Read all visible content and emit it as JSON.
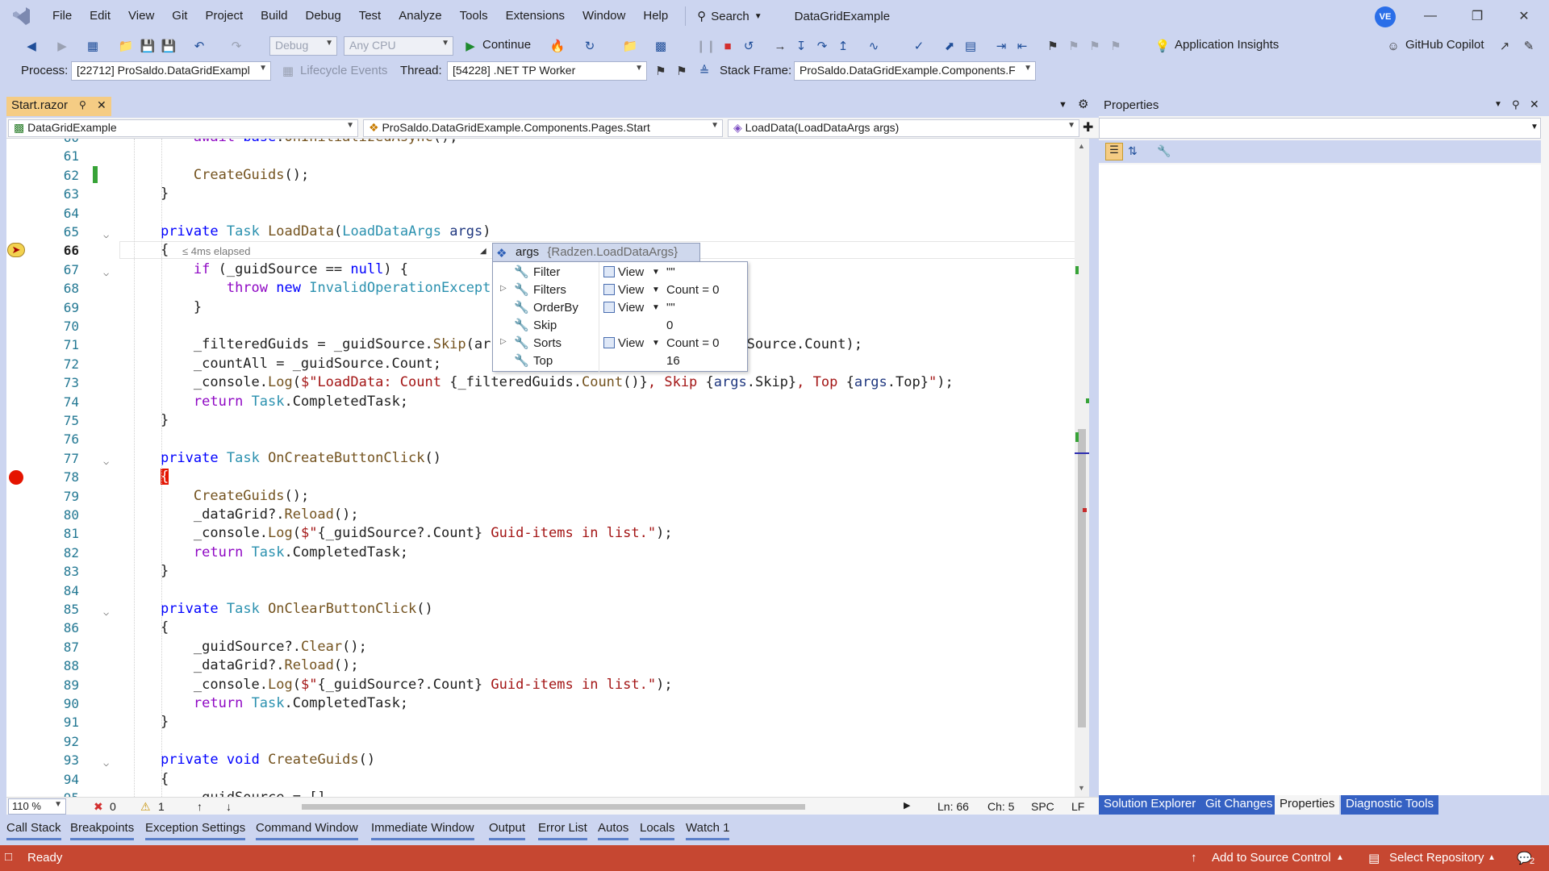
{
  "menu": [
    "File",
    "Edit",
    "View",
    "Git",
    "Project",
    "Build",
    "Debug",
    "Test",
    "Analyze",
    "Tools",
    "Extensions",
    "Window",
    "Help"
  ],
  "search_label": "Search",
  "solution_name": "DataGridExample",
  "avatar_initials": "VE",
  "toolbar": {
    "config": "Debug",
    "platform": "Any CPU",
    "continue_label": "Continue",
    "app_insights": "Application Insights",
    "copilot": "GitHub Copilot"
  },
  "debug_location": {
    "process_label": "Process:",
    "process_value": "[22712] ProSaldo.DataGridExampl",
    "lifecycle": "Lifecycle Events",
    "thread_label": "Thread:",
    "thread_value": "[54228] .NET TP Worker",
    "stack_label": "Stack Frame:",
    "stack_value": "ProSaldo.DataGridExample.Components.F"
  },
  "doc_tab": "Start.razor",
  "nav": {
    "project": "DataGridExample",
    "type": "ProSaldo.DataGridExample.Components.Pages.Start",
    "member": "LoadData(LoadDataArgs args)"
  },
  "code_lines": [
    {
      "n": "60",
      "html": "        <span class=\"kw\">await</span> <span class=\"kb\">base</span>.<span class=\"mt\">OnInitializedAsync</span>();"
    },
    {
      "n": "61",
      "html": ""
    },
    {
      "n": "62",
      "html": "        <span class=\"mt\">CreateGuids</span>();"
    },
    {
      "n": "63",
      "html": "    }"
    },
    {
      "n": "64",
      "html": ""
    },
    {
      "n": "65",
      "html": "    <span class=\"kb\">private</span> <span class=\"ty\">Task</span> <span class=\"mt\">LoadData</span>(<span class=\"ty\">LoadDataArgs</span> <span class=\"pm\">args</span>)"
    },
    {
      "n": "66",
      "html": "    {"
    },
    {
      "n": "67",
      "html": "        <span class=\"kw\">if</span> (_guidSource == <span class=\"kb\">null</span>) {"
    },
    {
      "n": "68",
      "html": "            <span class=\"kw\">throw</span> <span class=\"kb\">new</span> <span class=\"ty\">InvalidOperationExcept</span>"
    },
    {
      "n": "69",
      "html": "        }"
    },
    {
      "n": "70",
      "html": ""
    },
    {
      "n": "71",
      "html": "        _filteredGuids = _guidSource.<span class=\"mt\">Skip</span>(ar                          _guidSource.Count);"
    },
    {
      "n": "72",
      "html": "        _countAll = _guidSource.Count;"
    },
    {
      "n": "73",
      "html": "        _console.<span class=\"mt\">Log</span>(<span class=\"st\">$\"LoadData: Count </span>{_filteredGuids.<span class=\"mt\">Count</span>()}<span class=\"st\">, Skip </span>{<span class=\"pm\">args</span>.Skip}<span class=\"st\">, Top </span>{<span class=\"pm\">args</span>.Top}<span class=\"st\">\"</span>);"
    },
    {
      "n": "74",
      "html": "        <span class=\"kw\">return</span> <span class=\"ty\">Task</span>.CompletedTask;"
    },
    {
      "n": "75",
      "html": "    }"
    },
    {
      "n": "76",
      "html": ""
    },
    {
      "n": "77",
      "html": "    <span class=\"kb\">private</span> <span class=\"ty\">Task</span> <span class=\"mt\">OnCreateButtonClick</span>()"
    },
    {
      "n": "78",
      "html": "    <span class=\"bp-highlight\">{</span>"
    },
    {
      "n": "79",
      "html": "        <span class=\"mt\">CreateGuids</span>();"
    },
    {
      "n": "80",
      "html": "        _dataGrid?.<span class=\"mt\">Reload</span>();"
    },
    {
      "n": "81",
      "html": "        _console.<span class=\"mt\">Log</span>(<span class=\"st\">$\"</span>{_guidSource?.Count}<span class=\"st\"> Guid-items in list.\"</span>);"
    },
    {
      "n": "82",
      "html": "        <span class=\"kw\">return</span> <span class=\"ty\">Task</span>.CompletedTask;"
    },
    {
      "n": "83",
      "html": "    }"
    },
    {
      "n": "84",
      "html": ""
    },
    {
      "n": "85",
      "html": "    <span class=\"kb\">private</span> <span class=\"ty\">Task</span> <span class=\"mt\">OnClearButtonClick</span>()"
    },
    {
      "n": "86",
      "html": "    {"
    },
    {
      "n": "87",
      "html": "        _guidSource?.<span class=\"mt\">Clear</span>();"
    },
    {
      "n": "88",
      "html": "        _dataGrid?.<span class=\"mt\">Reload</span>();"
    },
    {
      "n": "89",
      "html": "        _console.<span class=\"mt\">Log</span>(<span class=\"st\">$\"</span>{_guidSource?.Count}<span class=\"st\"> Guid-items in list.\"</span>);"
    },
    {
      "n": "90",
      "html": "        <span class=\"kw\">return</span> <span class=\"ty\">Task</span>.CompletedTask;"
    },
    {
      "n": "91",
      "html": "    }"
    },
    {
      "n": "92",
      "html": ""
    },
    {
      "n": "93",
      "html": "    <span class=\"kb\">private</span> <span class=\"kb\">void</span> <span class=\"mt\">CreateGuids</span>()"
    },
    {
      "n": "94",
      "html": "    {"
    },
    {
      "n": "95",
      "html": "        _guidSource = []"
    }
  ],
  "elapsed": "≤ 4ms elapsed",
  "datatip": {
    "name": "args",
    "value": "{Radzen.LoadDataArgs}",
    "rows": [
      {
        "name": "Filter",
        "expandable": false,
        "view": "View",
        "value": "\"\""
      },
      {
        "name": "Filters",
        "expandable": true,
        "view": "View",
        "value": "Count = 0"
      },
      {
        "name": "OrderBy",
        "expandable": false,
        "view": "View",
        "value": "\"\""
      },
      {
        "name": "Skip",
        "expandable": false,
        "view": "",
        "value": "0"
      },
      {
        "name": "Sorts",
        "expandable": true,
        "view": "View",
        "value": "Count = 0"
      },
      {
        "name": "Top",
        "expandable": false,
        "view": "",
        "value": "16"
      }
    ]
  },
  "editor_status": {
    "zoom": "110 %",
    "errors": "0",
    "warnings": "1",
    "ln": "Ln: 66",
    "ch": "Ch: 5",
    "spc": "SPC",
    "lf": "LF"
  },
  "properties_title": "Properties",
  "right_tabs": [
    "Solution Explorer",
    "Git Changes",
    "Properties",
    "Diagnostic Tools"
  ],
  "bottom_tabs": [
    "Call Stack",
    "Breakpoints",
    "Exception Settings",
    "Command Window",
    "Immediate Window",
    "Output",
    "Error List",
    "Autos",
    "Locals",
    "Watch 1"
  ],
  "status": {
    "ready": "Ready",
    "source_control": "Add to Source Control",
    "repository": "Select Repository",
    "notifications": "2"
  },
  "colors": {
    "accent": "#ccd5f0",
    "statusbar": "#c64731",
    "breakpoint": "#e51400",
    "tab_active": "#f5cc84"
  }
}
